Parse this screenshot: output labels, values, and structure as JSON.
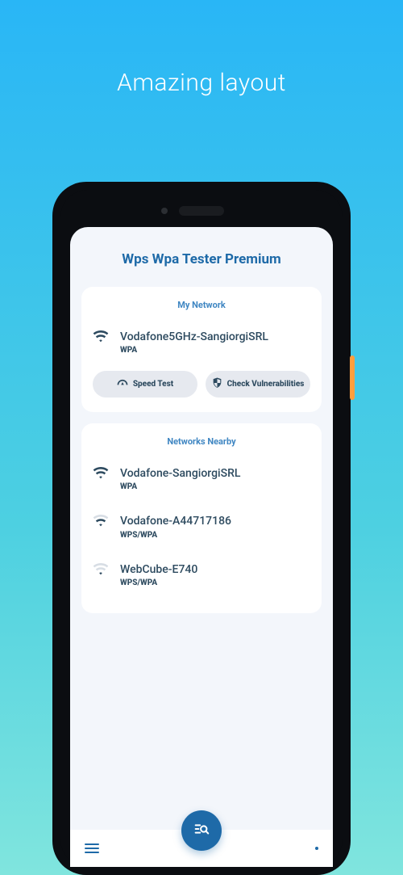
{
  "headline": "Amazing layout",
  "app": {
    "title": "Wps Wpa Tester Premium"
  },
  "myNetwork": {
    "header": "My Network",
    "network": {
      "name": "Vodafone5GHz-SangiorgiSRL",
      "security": "WPA",
      "signal": "full"
    },
    "actions": {
      "speedTest": "Speed Test",
      "checkVuln": "Check Vulnerabilities"
    }
  },
  "nearby": {
    "header": "Networks Nearby",
    "items": [
      {
        "name": "Vodafone-SangiorgiSRL",
        "security": "WPA",
        "signal": "full"
      },
      {
        "name": "Vodafone-A44717186",
        "security": "WPS/WPA",
        "signal": "mid"
      },
      {
        "name": "WebCube-E740",
        "security": "WPS/WPA",
        "signal": "low"
      }
    ]
  },
  "icons": {
    "menu": "hamburger-menu",
    "more": "more-horizontal",
    "fab": "scan-search",
    "speed": "speedometer",
    "shield": "shield-check"
  },
  "colors": {
    "brand": "#1e6aa8",
    "text": "#2d4a5f",
    "pillBg": "#e6e9ef"
  }
}
